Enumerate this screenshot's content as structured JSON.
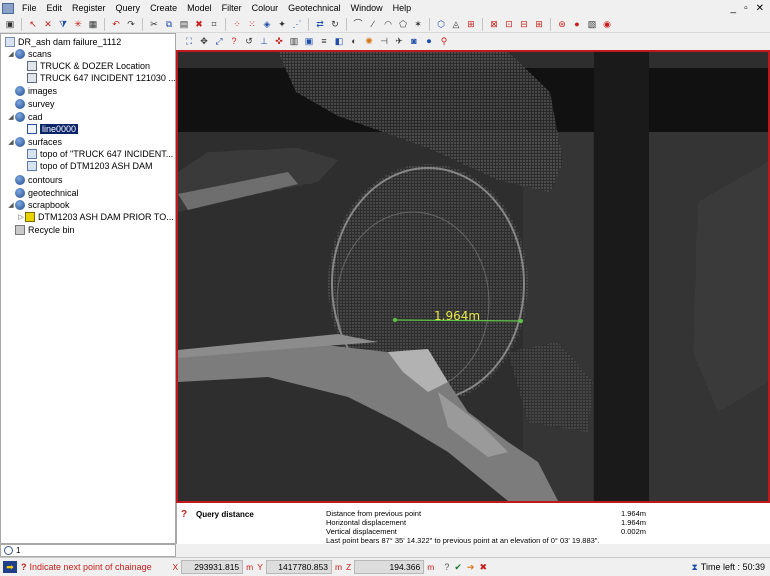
{
  "menu": {
    "items": [
      "File",
      "Edit",
      "Register",
      "Query",
      "Create",
      "Model",
      "Filter",
      "Colour",
      "Geotechnical",
      "Window",
      "Help"
    ],
    "window_controls": [
      "_",
      "▫",
      "✕"
    ]
  },
  "tree": {
    "root": "DR_ash dam failure_1112",
    "scans": "scans",
    "scan_item_1": "TRUCK & DOZER Location",
    "scan_item_2": "TRUCK 647 INCIDENT 121030 ...",
    "images": "images",
    "survey": "survey",
    "cad": "cad",
    "cad_item_1": "line0000",
    "surfaces": "surfaces",
    "surface_item_1": "topo of \"TRUCK 647 INCIDENT...",
    "surface_item_2": "topo of DTM1203 ASH DAM",
    "contours": "contours",
    "geotechnical": "geotechnical",
    "scrapbook": "scrapbook",
    "scrapbook_item_1": "DTM1203 ASH DAM PRIOR TO...",
    "recycle_bin": "Recycle bin"
  },
  "tree_footer": {
    "count": "1"
  },
  "viewport": {
    "measurement_label": "1.964m",
    "measure_color": "#e9e84a",
    "line_color": "#5fc447",
    "border_color": "#c0181c"
  },
  "query": {
    "title": "Query distance",
    "rows": [
      {
        "label": "Distance from previous point",
        "value": "1.964m"
      },
      {
        "label": "Horizontal displacement",
        "value": "1.964m"
      },
      {
        "label": "Vertical displacement",
        "value": "0.002m"
      }
    ],
    "bearing": "Last point bears 87° 35' 14.322\" to previous point at an elevation of 0° 03' 19.883\"."
  },
  "status": {
    "prompt": "Indicate next point of chainage",
    "x_axis": "X",
    "x_value": "293931.815",
    "x_unit": "m",
    "y_axis": "Y",
    "y_value": "1417780.853",
    "y_unit": "m",
    "z_axis": "Z",
    "z_value": "194.366",
    "z_unit": "m",
    "time_left": "Time left : 50:39"
  }
}
